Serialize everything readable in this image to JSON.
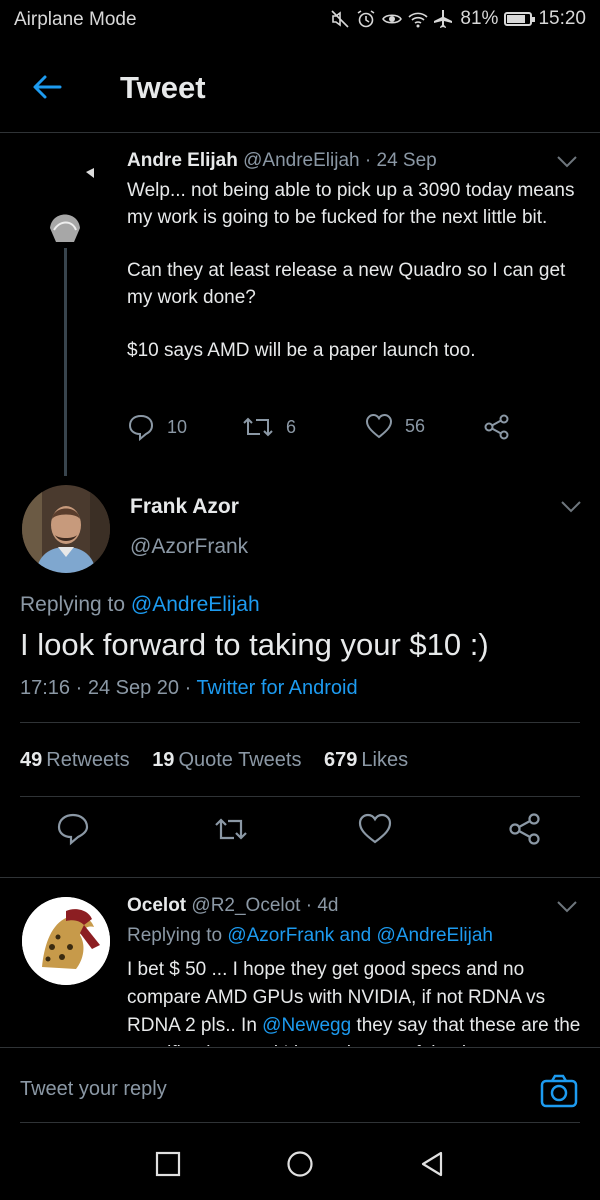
{
  "status_bar": {
    "mode": "Airplane Mode",
    "battery_percent": "81%",
    "battery_level": 0.81,
    "time": "15:20"
  },
  "header": {
    "title": "Tweet"
  },
  "parent_tweet": {
    "name": "Andre Elijah",
    "handle": "@AndreElijah",
    "date": "24 Sep",
    "paragraphs": [
      "Welp... not being able to pick up a 3090 today means my work is going to be fucked for the next little bit.",
      "Can they at least release a new Quadro so I can get my work done?",
      "$10 says AMD will be a paper launch too."
    ],
    "replies": "10",
    "retweets": "6",
    "likes": "56"
  },
  "main_tweet": {
    "name": "Frank Azor",
    "handle": "@AzorFrank",
    "replying_prefix": "Replying to",
    "replying_to": "@AndreElijah",
    "text": "I look forward to taking your $10 :)",
    "timestamp": "17:16 · 24 Sep 20 ·",
    "source": "Twitter for Android",
    "stats": {
      "retweets_count": "49",
      "retweets_label": "Retweets",
      "quotes_count": "19",
      "quotes_label": "Quote Tweets",
      "likes_count": "679",
      "likes_label": "Likes"
    }
  },
  "reply_tweet": {
    "name": "Ocelot",
    "handle": "@R2_Ocelot",
    "age": "4d",
    "replying_prefix": "Replying to",
    "replying_to_1": "@AzorFrank",
    "replying_and": "and",
    "replying_to_2": "@AndreElijah",
    "text_before": "I bet $ 50 ... I hope they get good specs and no compare AMD GPUs  with NVIDIA, if not RDNA vs RDNA 2 pls.. In ",
    "mention": "@Newegg",
    "text_after": " they say that these are the specifications and I hope they are fake, it"
  },
  "composer": {
    "placeholder": "Tweet your reply"
  },
  "colors": {
    "accent": "#1d9bf0",
    "muted": "#8b98a5",
    "background": "#000000"
  }
}
